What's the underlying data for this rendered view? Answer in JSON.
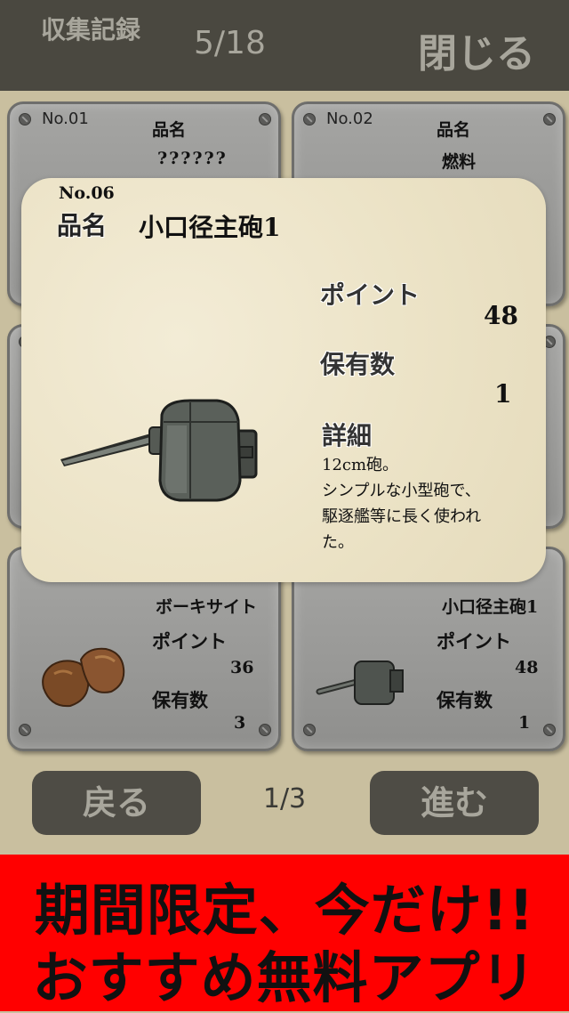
{
  "header": {
    "title": "収集記録",
    "count": "5/18",
    "close_label": "閉じる"
  },
  "cards": [
    {
      "no": "No.01",
      "name_label": "品名",
      "name": "??????"
    },
    {
      "no": "No.02",
      "name_label": "品名",
      "name": "燃料"
    },
    {
      "name": "ボーキサイト",
      "points_label": "ポイント",
      "points": "36",
      "count_label": "保有数",
      "count": "3",
      "icon": "bauxite-icon"
    },
    {
      "name": "小口径主砲1",
      "points_label": "ポイント",
      "points": "48",
      "count_label": "保有数",
      "count": "1",
      "icon": "gun-turret-icon"
    }
  ],
  "modal": {
    "no": "No.06",
    "name_label": "品名",
    "name": "小口径主砲1",
    "points_label": "ポイント",
    "points": "48",
    "count_label": "保有数",
    "count": "1",
    "detail_label": "詳細",
    "detail_lines": [
      "12cm砲。",
      "シンプルな小型砲で、",
      "駆逐艦等に長く使われ",
      "た。"
    ],
    "icon": "gun-turret-icon"
  },
  "nav": {
    "back_label": "戻る",
    "page": "1/3",
    "next_label": "進む"
  },
  "ad": {
    "line1": "期間限定、今だけ!!",
    "line2": "おすすめ無料アプリ",
    "background": "#ff0000"
  }
}
